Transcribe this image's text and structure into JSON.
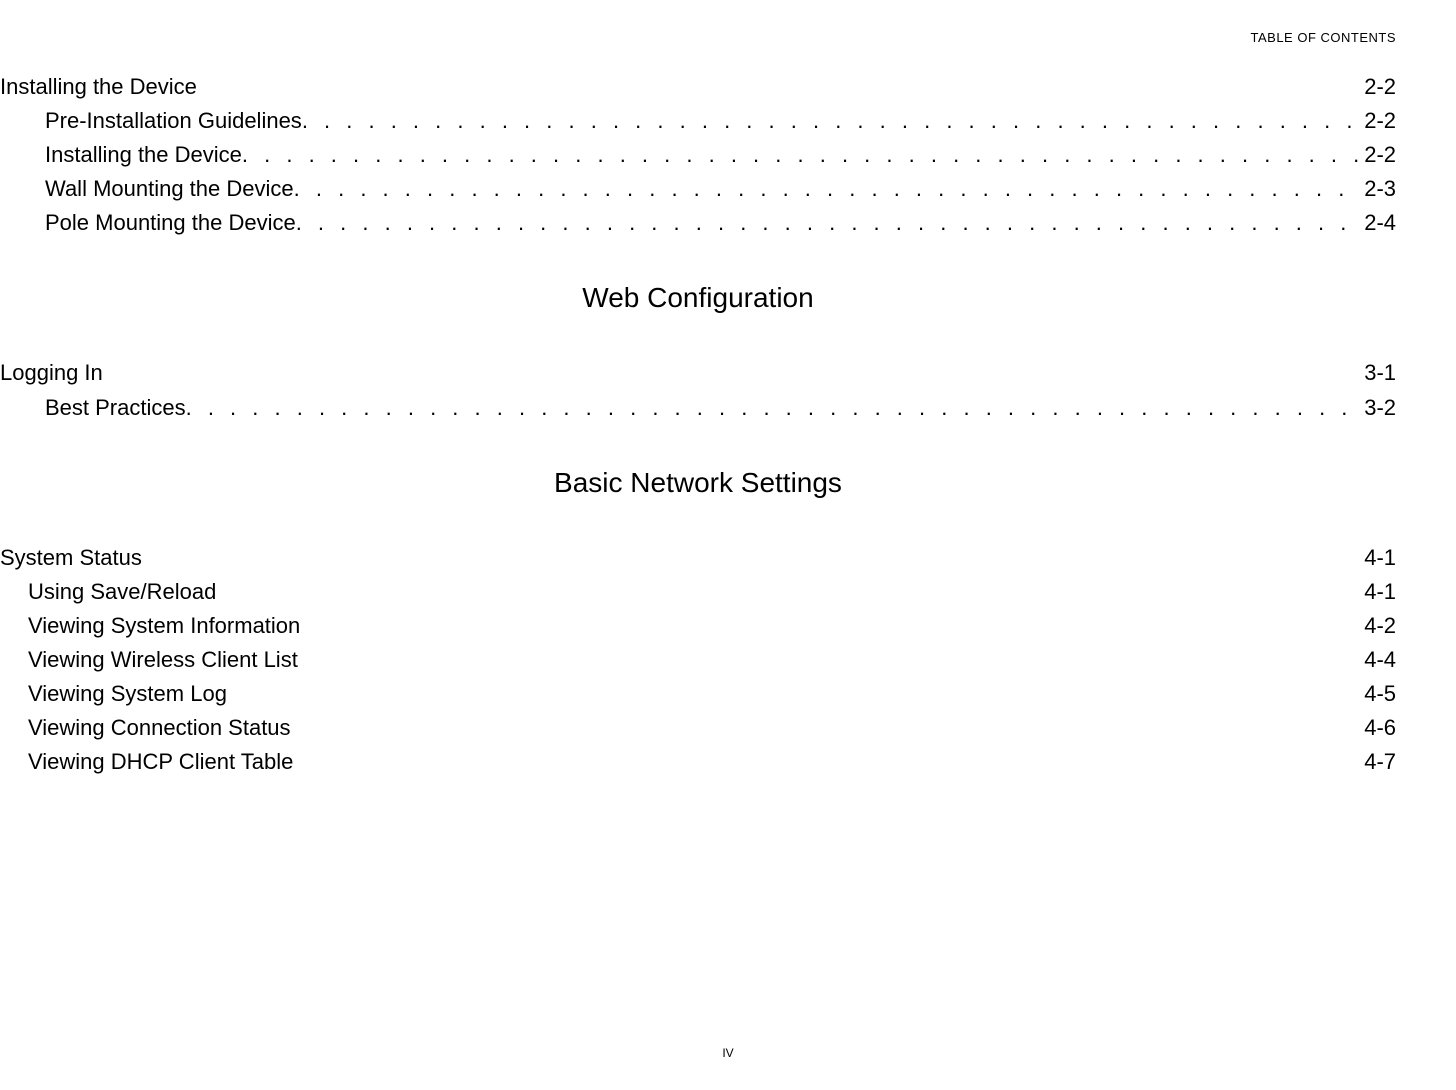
{
  "header": {
    "label": "TABLE OF CONTENTS"
  },
  "sections": {
    "s1": {
      "h1": {
        "title": "Installing the Device",
        "page": "2-2"
      },
      "items": [
        {
          "title": "Pre-Installation Guidelines",
          "page": "2-2"
        },
        {
          "title": "Installing the Device",
          "page": "2-2"
        },
        {
          "title": "Wall Mounting the Device",
          "page": "2-3"
        },
        {
          "title": "Pole Mounting the Device",
          "page": "2-4"
        }
      ]
    },
    "s2": {
      "heading": "Web Configuration",
      "h1": {
        "title": "Logging In",
        "page": "3-1"
      },
      "items": [
        {
          "title": "Best Practices",
          "page": "3-2"
        }
      ]
    },
    "s3": {
      "heading": "Basic Network Settings",
      "h1": {
        "title": "System Status",
        "page": "4-1"
      },
      "items": [
        {
          "title": "Using Save/Reload",
          "page": "4-1"
        },
        {
          "title": "Viewing System Information",
          "page": "4-2"
        },
        {
          "title": "Viewing Wireless Client List",
          "page": "4-4"
        },
        {
          "title": "Viewing System Log",
          "page": "4-5"
        },
        {
          "title": "Viewing Connection Status",
          "page": "4-6"
        },
        {
          "title": "Viewing DHCP Client Table",
          "page": "4-7"
        }
      ]
    }
  },
  "footer": {
    "page_number": "IV"
  }
}
